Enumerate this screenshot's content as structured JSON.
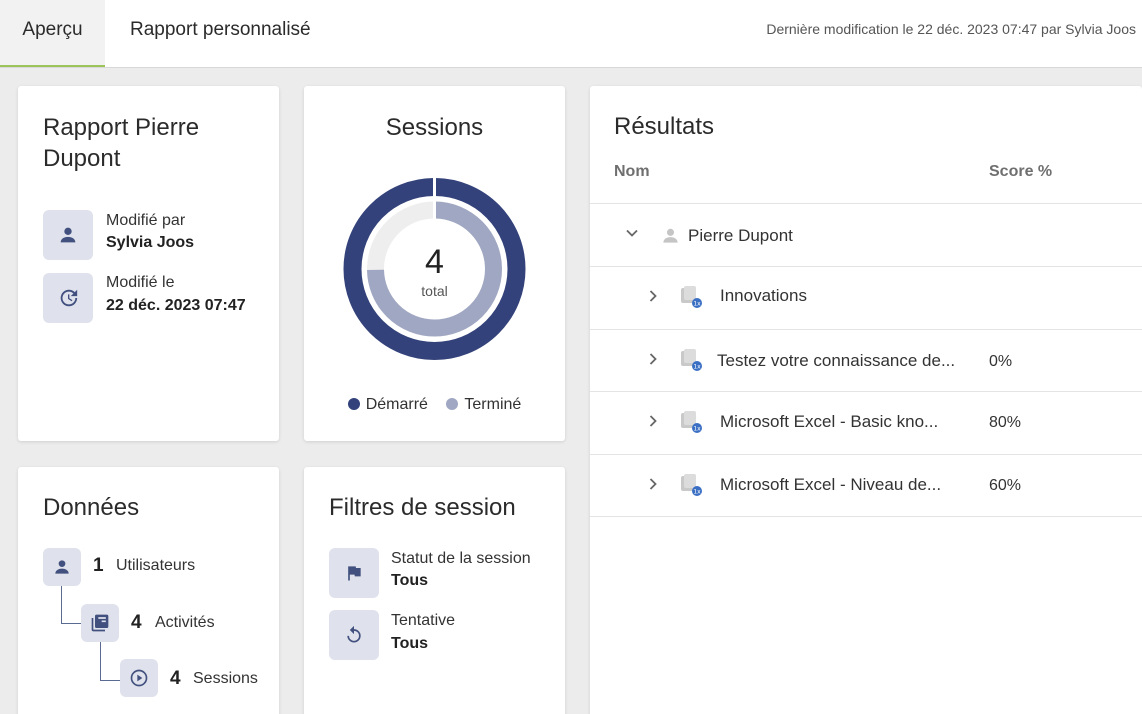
{
  "tabs": [
    {
      "label": "Aperçu",
      "active": true
    },
    {
      "label": "Rapport personnalisé",
      "active": false
    }
  ],
  "last_modified": "Dernière modification le 22 déc. 2023 07:47 par Sylvia Joos",
  "report": {
    "title": "Rapport Pierre Dupont",
    "modified_by_label": "Modifié par",
    "modified_by_value": "Sylvia Joos",
    "modified_on_label": "Modifié le",
    "modified_on_value": "22 déc. 2023 07:47"
  },
  "sessions": {
    "title": "Sessions",
    "total": "4",
    "total_label": "total",
    "legend": [
      {
        "label": "Démarré",
        "color": "#33427a"
      },
      {
        "label": "Terminé",
        "color": "#a0a7c2"
      }
    ]
  },
  "chart_data": {
    "type": "pie",
    "title": "Sessions",
    "series": [
      {
        "name": "Démarré",
        "values": [
          4
        ]
      },
      {
        "name": "Terminé",
        "values": [
          3
        ]
      }
    ],
    "total": 4
  },
  "results": {
    "title": "Résultats",
    "col_name": "Nom",
    "col_score": "Score %",
    "user": "Pierre Dupont",
    "rows": [
      {
        "name": "Innovations",
        "score": ""
      },
      {
        "name": "Testez votre connaissance de...",
        "score": "0%"
      },
      {
        "name": "Microsoft Excel - Basic kno...",
        "score": "80%"
      },
      {
        "name": "Microsoft Excel - Niveau de...",
        "score": "60%"
      }
    ]
  },
  "data_card": {
    "title": "Données",
    "users_count": "1",
    "users_label": "Utilisateurs",
    "activities_count": "4",
    "activities_label": "Activités",
    "sessions_count": "4",
    "sessions_label": "Sessions"
  },
  "filters": {
    "title": "Filtres de session",
    "status_label": "Statut de la session",
    "status_value": "Tous",
    "attempt_label": "Tentative",
    "attempt_value": "Tous"
  },
  "colors": {
    "accent": "#9bc45a",
    "navy": "#33427a",
    "light_navy": "#a0a7c2"
  }
}
